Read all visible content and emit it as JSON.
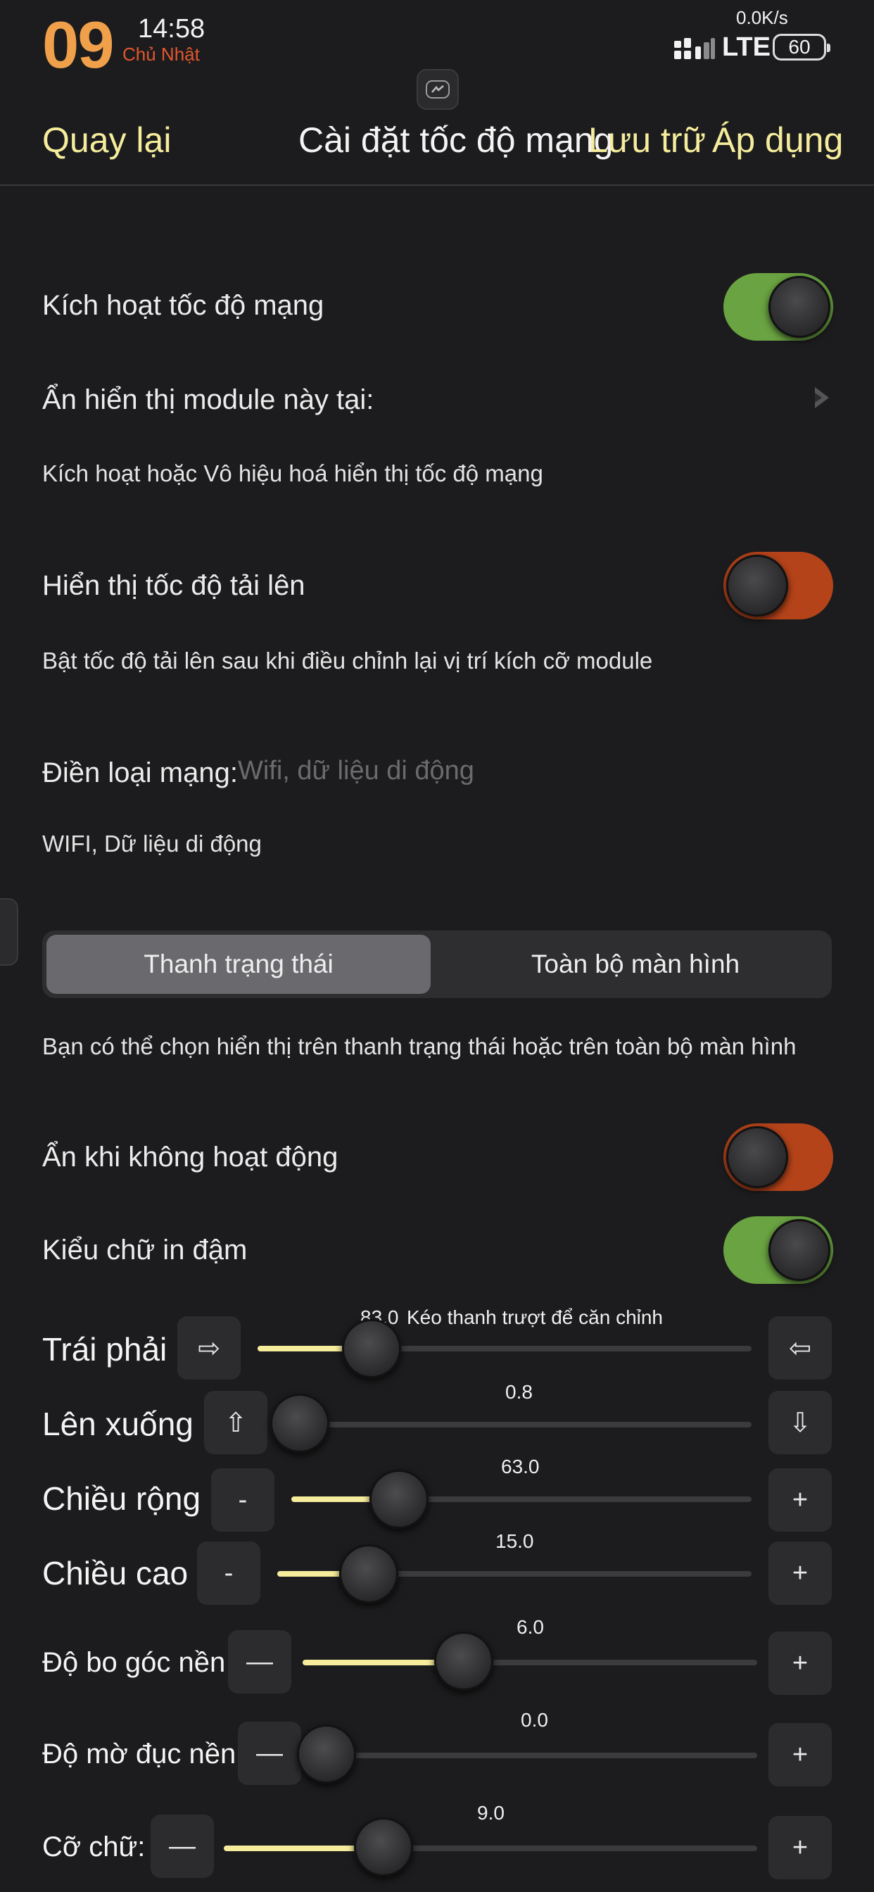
{
  "status_bar": {
    "day": "09",
    "time": "14:58",
    "weekday": "Chủ Nhật",
    "net_speed": "0.0K/s",
    "network": "LTE",
    "battery": "60"
  },
  "nav": {
    "back": "Quay lại",
    "title": "Cài đặt tốc độ mạng",
    "save": "Lưu trữ",
    "apply": "Áp dụng"
  },
  "settings": {
    "enable_speed": {
      "label": "Kích hoạt tốc độ mạng",
      "on": true
    },
    "hide_module": {
      "label": "Ẩn hiển thị module này tại:"
    },
    "enable_desc": "Kích hoạt hoặc Vô hiệu hoá hiển thị tốc độ mạng",
    "show_upload": {
      "label": "Hiển thị tốc độ tải lên",
      "on": false
    },
    "upload_desc": "Bật tốc độ tải lên sau khi điều chỉnh lại vị trí kích cỡ module",
    "network_type": {
      "label": "Điền loại mạng:",
      "placeholder": "Wifi, dữ liệu di động",
      "value": ""
    },
    "network_value": "WIFI, Dữ liệu di động",
    "display_mode": {
      "options": [
        "Thanh trạng thái",
        "Toàn bộ màn hình"
      ],
      "selected": "Thanh trạng thái"
    },
    "display_desc": "Bạn có thể chọn hiển thị trên thanh trạng thái hoặc trên toàn bộ màn hình",
    "hide_inactive": {
      "label": "Ẩn khi không hoạt động",
      "on": false
    },
    "bold_font": {
      "label": "Kiểu chữ in đậm",
      "on": true
    }
  },
  "sliders": [
    {
      "label": "Trái phải",
      "value": "83.0",
      "level": 0.2,
      "minus": "⇨",
      "plus": "⇦",
      "hint": "Kéo thanh trượt để căn chỉnh"
    },
    {
      "label": "Lên xuống",
      "value": "0.8",
      "level": 0.0,
      "minus": "⇧",
      "plus": "⇩"
    },
    {
      "label": "Chiều rộng",
      "value": "63.0",
      "level": 0.2,
      "minus": "-",
      "plus": "+"
    },
    {
      "label": "Chiều cao",
      "value": "15.0",
      "level": 0.16,
      "minus": "-",
      "plus": "+"
    },
    {
      "label": "Độ bo góc nền",
      "value": "6.0",
      "level": 0.32,
      "minus": "—",
      "plus": "+"
    },
    {
      "label": "Độ mờ đục nền",
      "value": "0.0",
      "level": 0.0,
      "minus": "—",
      "plus": "+"
    },
    {
      "label": "Cỡ chữ:",
      "value": "9.0",
      "level": 0.27,
      "minus": "—",
      "plus": "+"
    }
  ],
  "colors": {
    "accent": "#f5ec9c",
    "toggle_on": "#6aa341",
    "toggle_off": "#b5431a",
    "day": "#f0a04a",
    "weekday": "#e2572d"
  }
}
